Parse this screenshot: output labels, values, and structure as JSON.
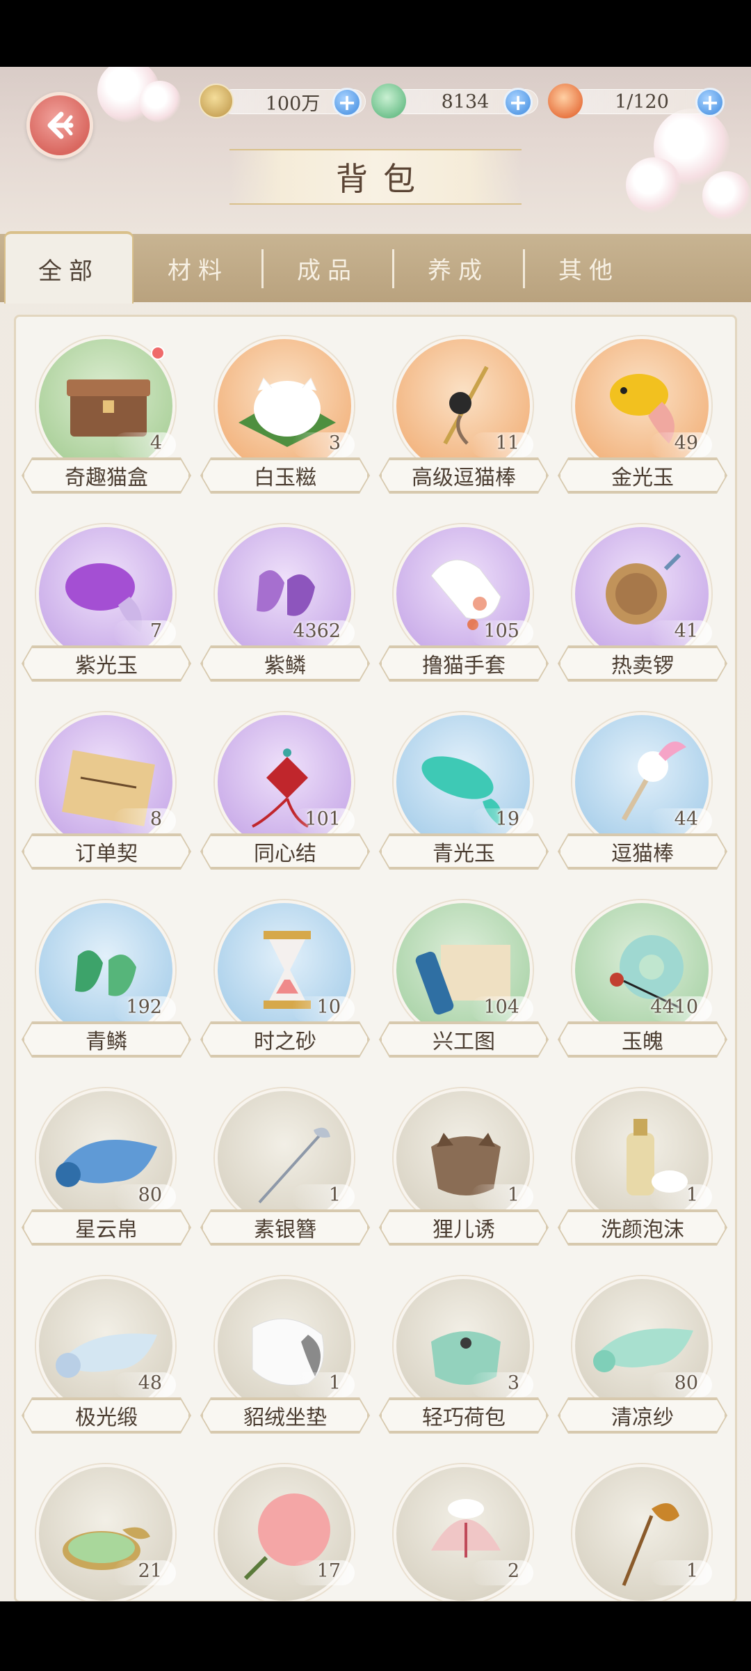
{
  "header": {
    "title": "背包",
    "back_icon": "arrow-left-icon",
    "resources": [
      {
        "name": "paw-coin",
        "value": "100万"
      },
      {
        "name": "green-gem",
        "value": "8134"
      },
      {
        "name": "bun-stamina",
        "value": "1/120"
      }
    ]
  },
  "tabs": [
    {
      "label": "全部",
      "active": true
    },
    {
      "label": "材料",
      "active": false
    },
    {
      "label": "成品",
      "active": false
    },
    {
      "label": "养成",
      "active": false
    },
    {
      "label": "其他",
      "active": false
    }
  ],
  "items": [
    {
      "name": "奇趣猫盒",
      "count": "4",
      "bg": "green",
      "icon": "wooden-box-icon",
      "new": true
    },
    {
      "name": "白玉糍",
      "count": "3",
      "bg": "orange",
      "icon": "cat-mochi-icon"
    },
    {
      "name": "高级逗猫棒",
      "count": "11",
      "bg": "orange",
      "icon": "cat-wand-icon"
    },
    {
      "name": "金光玉",
      "count": "49",
      "bg": "orange",
      "icon": "gold-fish-jade-icon"
    },
    {
      "name": "紫光玉",
      "count": "7",
      "bg": "purple",
      "icon": "purple-fish-jade-icon"
    },
    {
      "name": "紫鳞",
      "count": "4362",
      "bg": "purple",
      "icon": "purple-scales-icon"
    },
    {
      "name": "撸猫手套",
      "count": "105",
      "bg": "purple",
      "icon": "cat-glove-icon"
    },
    {
      "name": "热卖锣",
      "count": "41",
      "bg": "purple",
      "icon": "gong-icon"
    },
    {
      "name": "订单契",
      "count": "8",
      "bg": "purple",
      "icon": "contract-scroll-icon"
    },
    {
      "name": "同心结",
      "count": "101",
      "bg": "purple",
      "icon": "knot-icon"
    },
    {
      "name": "青光玉",
      "count": "19",
      "bg": "blue",
      "icon": "cyan-fish-jade-icon"
    },
    {
      "name": "逗猫棒",
      "count": "44",
      "bg": "blue",
      "icon": "feather-wand-icon"
    },
    {
      "name": "青鳞",
      "count": "192",
      "bg": "blue",
      "icon": "green-scales-icon"
    },
    {
      "name": "时之砂",
      "count": "10",
      "bg": "blue",
      "icon": "hourglass-icon"
    },
    {
      "name": "兴工图",
      "count": "104",
      "bg": "tealgreen",
      "icon": "blueprint-scroll-icon"
    },
    {
      "name": "玉魄",
      "count": "4410",
      "bg": "tealgreen",
      "icon": "jade-disc-icon"
    },
    {
      "name": "星云帛",
      "count": "80",
      "bg": "gray",
      "icon": "blue-silk-icon"
    },
    {
      "name": "素银簪",
      "count": "1",
      "bg": "gray",
      "icon": "silver-hairpin-icon"
    },
    {
      "name": "狸儿诱",
      "count": "1",
      "bg": "gray",
      "icon": "cat-pouch-icon"
    },
    {
      "name": "洗颜泡沫",
      "count": "1",
      "bg": "gray",
      "icon": "foam-bottle-icon"
    },
    {
      "name": "极光缎",
      "count": "48",
      "bg": "gray",
      "icon": "aurora-satin-icon"
    },
    {
      "name": "貂绒坐垫",
      "count": "1",
      "bg": "gray",
      "icon": "fur-cushion-icon"
    },
    {
      "name": "轻巧荷包",
      "count": "3",
      "bg": "gray",
      "icon": "green-purse-icon"
    },
    {
      "name": "清凉纱",
      "count": "80",
      "bg": "gray",
      "icon": "mint-gauze-icon"
    },
    {
      "name": "",
      "count": "21",
      "bg": "gray",
      "icon": "powder-box-icon"
    },
    {
      "name": "",
      "count": "17",
      "bg": "gray",
      "icon": "pink-fan-icon"
    },
    {
      "name": "",
      "count": "2",
      "bg": "gray",
      "icon": "pink-hat-icon"
    },
    {
      "name": "",
      "count": "1",
      "bg": "gray",
      "icon": "gold-hairpin-icon"
    }
  ]
}
